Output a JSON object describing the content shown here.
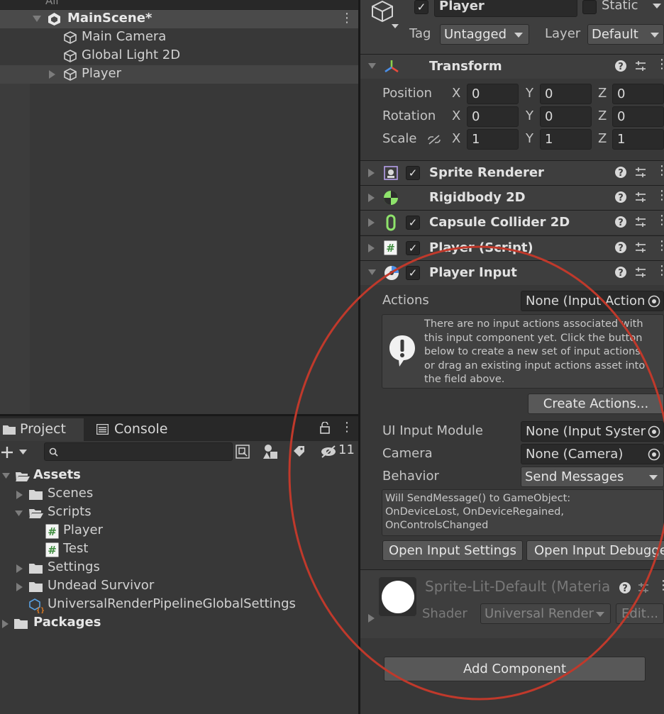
{
  "hierarchy": {
    "search_placeholder": "All",
    "scene_name": "MainScene*",
    "items": [
      {
        "label": "Main Camera"
      },
      {
        "label": "Global Light 2D"
      },
      {
        "label": "Player"
      }
    ]
  },
  "project": {
    "tabs": [
      {
        "label": "Project"
      },
      {
        "label": "Console"
      }
    ],
    "hidden_count": "11",
    "tree": [
      {
        "label": "Assets"
      },
      {
        "label": "Scenes"
      },
      {
        "label": "Scripts"
      },
      {
        "label": "Player"
      },
      {
        "label": "Test"
      },
      {
        "label": "Settings"
      },
      {
        "label": "Undead Survivor"
      },
      {
        "label": "UniversalRenderPipelineGlobalSettings"
      },
      {
        "label": "Packages"
      }
    ]
  },
  "inspector": {
    "object_name": "Player",
    "static_label": "Static",
    "tag_label": "Tag",
    "tag_value": "Untagged",
    "layer_label": "Layer",
    "layer_value": "Default",
    "transform": {
      "title": "Transform",
      "rows": [
        {
          "label": "Position",
          "x": "0",
          "y": "0",
          "z": "0"
        },
        {
          "label": "Rotation",
          "x": "0",
          "y": "0",
          "z": "0"
        },
        {
          "label": "Scale",
          "x": "1",
          "y": "1",
          "z": "1"
        }
      ],
      "axis_x": "X",
      "axis_y": "Y",
      "axis_z": "Z"
    },
    "components": [
      {
        "title": "Sprite Renderer",
        "checked": true,
        "icon": "sprite-renderer-icon"
      },
      {
        "title": "Rigidbody 2D",
        "checked": false,
        "icon": "rigidbody-icon"
      },
      {
        "title": "Capsule Collider 2D",
        "checked": true,
        "icon": "capsule-collider-icon"
      },
      {
        "title": "Player (Script)",
        "checked": true,
        "icon": "script-icon"
      }
    ],
    "player_input": {
      "title": "Player Input",
      "actions_label": "Actions",
      "actions_value": "None (Input Action",
      "help_text_lines": [
        "There are no input actions associated with",
        "this input component yet. Click the button",
        "below to create a new set of input actions",
        "or drag an existing input actions asset into",
        "the field above."
      ],
      "create_actions_button": "Create Actions...",
      "ui_input_module_label": "UI Input Module",
      "ui_input_module_value": "None (Input Syster",
      "camera_label": "Camera",
      "camera_value": "None (Camera)",
      "behavior_label": "Behavior",
      "behavior_value": "Send Messages",
      "message_lines": [
        "Will SendMessage() to GameObject:",
        "OnDeviceLost, OnDeviceRegained,",
        "OnControlsChanged"
      ],
      "open_settings_button": "Open Input Settings",
      "open_debugger_button": "Open Input Debugge"
    },
    "material": {
      "name": "Sprite-Lit-Default (Materia",
      "shader_label": "Shader",
      "shader_value": "Universal Render",
      "edit_button": "Edit..."
    },
    "add_component_button": "Add Component"
  },
  "colors": {
    "annotation_circle": "#c0392b",
    "background": "#383838",
    "checkmark": "#e5e5e5",
    "capsule_icon": "#8ee36b"
  }
}
